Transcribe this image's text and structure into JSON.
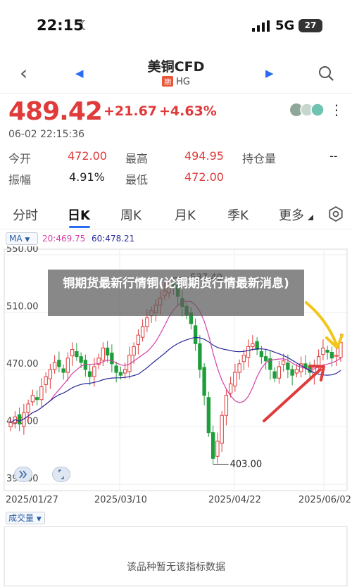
{
  "status_bar": {
    "time": "22:15",
    "network": "5G",
    "battery": "27"
  },
  "nav": {
    "title": "美铜CFD",
    "badge": "期",
    "code": "HG"
  },
  "quote": {
    "price": "489.42",
    "change": "+21.67",
    "change_pct": "+4.63%",
    "timestamp": "06-02 22:15:36"
  },
  "stats": {
    "open_label": "今开",
    "open": "472.00",
    "high_label": "最高",
    "high": "494.95",
    "oi_label": "持仓量",
    "oi": "--",
    "amp_label": "振幅",
    "amp": "4.91%",
    "low_label": "最低",
    "low": "472.00"
  },
  "tabs": [
    "分时",
    "日K",
    "周K",
    "月K",
    "季K",
    "更多"
  ],
  "indicator": {
    "ma_label": "MA",
    "ma20": "20:469.75",
    "ma60": "60:478.21"
  },
  "watermark": "铜期货最新行情铜(论铜期货行情最新消息)",
  "colors": {
    "up": "#e03a3a",
    "down": "#1e9e3a",
    "ma20": "#d43fa7",
    "ma60": "#2a2a9a",
    "accent": "#2a6df4"
  },
  "chart_data": {
    "type": "candlestick",
    "y_ticks": [
      "550.00",
      "510.00",
      "470.00",
      "430.00",
      "390.00"
    ],
    "ylim": [
      390,
      550
    ],
    "x_labels": [
      "2025/01/27",
      "2025/03/10",
      "2025/04/22",
      "2025/06/02"
    ],
    "max_label": "537.40",
    "min_label": "403.00",
    "close_series": [
      433,
      437,
      432,
      440,
      446,
      452,
      449,
      458,
      465,
      470,
      475,
      472,
      468,
      478,
      484,
      479,
      475,
      470,
      465,
      472,
      478,
      485,
      480,
      474,
      468,
      466,
      470,
      480,
      486,
      494,
      500,
      506,
      511,
      515,
      520,
      525,
      530,
      527,
      521,
      514,
      508,
      502,
      488,
      470,
      452,
      426,
      408,
      420,
      438,
      452,
      460,
      468,
      474,
      480,
      486,
      488,
      484,
      479,
      476,
      470,
      464,
      472,
      476,
      470,
      466,
      470,
      474,
      471,
      468,
      473,
      479,
      485,
      482,
      478,
      480,
      489
    ]
  },
  "volume": {
    "label": "成交量",
    "empty_text": "该品种暂无该指标数据"
  }
}
